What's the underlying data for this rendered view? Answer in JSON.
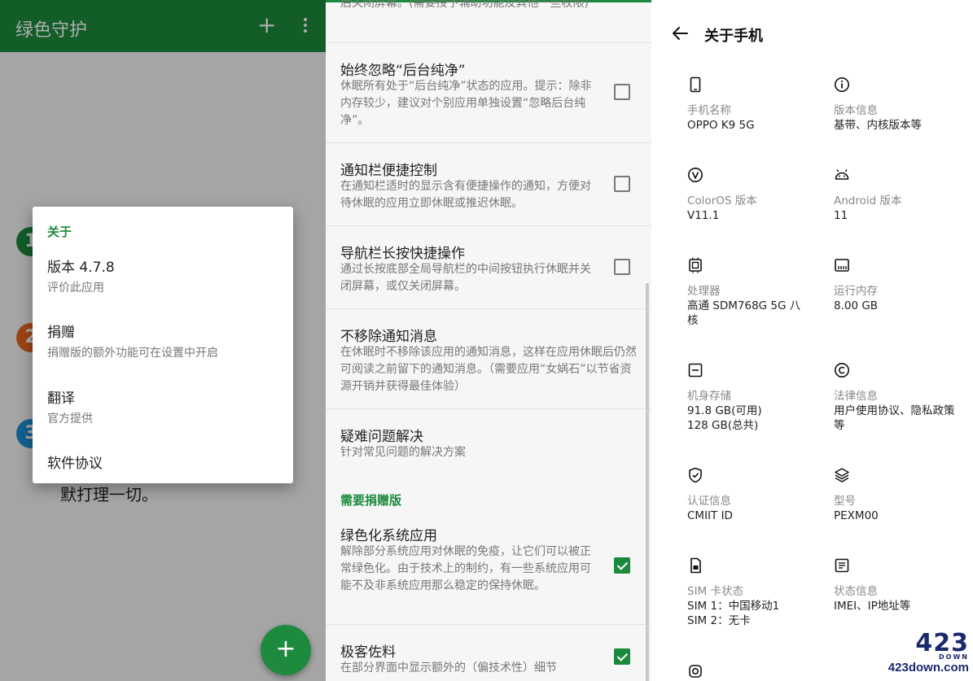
{
  "panel_about": {
    "app_title": "绿色守护",
    "step_numbers": [
      "1",
      "2",
      "3"
    ],
    "behind_text": "默打理一切。",
    "dialog": {
      "heading": "关于",
      "items": [
        {
          "title": "版本 4.7.8",
          "subtitle": "评价此应用"
        },
        {
          "title": "捐赠",
          "subtitle": "捐赠版的额外功能可在设置中开启"
        },
        {
          "title": "翻译",
          "subtitle": "官方提供"
        },
        {
          "title": "软件协议",
          "subtitle": ""
        }
      ]
    },
    "fab_label": "+"
  },
  "panel_settings": {
    "partial_top": "后关闭屏幕。(需要授予辅助功能及其他一些权限)",
    "items": [
      {
        "title": "始终忽略“后台纯净”",
        "desc": "休眠所有处于“后台纯净”状态的应用。提示：除非内存较少，建议对个别应用单独设置“忽略后台纯净”。",
        "checked": false
      },
      {
        "title": "通知栏便捷控制",
        "desc": "在通知栏适时的显示含有便捷操作的通知，方便对待休眠的应用立即休眠或推迟休眠。",
        "checked": false
      },
      {
        "title": "导航栏长按快捷操作",
        "desc": "通过长按底部全局导航栏的中间按钮执行休眠并关闭屏幕，或仅关闭屏幕。",
        "checked": false
      },
      {
        "title": "不移除通知消息",
        "desc": "在休眠时不移除该应用的通知消息，这样在应用休眠后仍然可阅读之前留下的通知消息。（需要应用“女娲石”以节省资源开销并获得最佳体验）"
      },
      {
        "title": "疑难问题解决",
        "desc": "针对常见问题的解决方案"
      }
    ],
    "section_donate": "需要捐赠版",
    "donate_items": [
      {
        "title": "绿色化系统应用",
        "desc": "解除部分系统应用对休眠的免疫，让它们可以被正常绿色化。由于技术上的制约，有一些系统应用可能不及非系统应用那么稳定的保持休眠。",
        "checked": true
      },
      {
        "title": "极客佐料",
        "desc": "在部分界面中显示额外的（偏技术性）细节",
        "checked": true
      }
    ]
  },
  "panel_phone": {
    "title": "关于手机",
    "cells": [
      {
        "icon": "phone-icon",
        "label": "手机名称",
        "value": "OPPO K9 5G"
      },
      {
        "icon": "info-icon",
        "label": "版本信息",
        "value": "基带、内核版本等"
      },
      {
        "icon": "coloros-icon",
        "label": "ColorOS 版本",
        "value": "V11.1"
      },
      {
        "icon": "android-icon",
        "label": "Android 版本",
        "value": "11"
      },
      {
        "icon": "cpu-icon",
        "label": "处理器",
        "value": "高通 SDM768G 5G 八核"
      },
      {
        "icon": "memory-icon",
        "label": "运行内存",
        "value": "8.00 GB"
      },
      {
        "icon": "storage-icon",
        "label": "机身存储",
        "value": "91.8 GB(可用)\n128 GB(总共)"
      },
      {
        "icon": "copyright-icon",
        "label": "法律信息",
        "value": "用户使用协议、隐私政策等"
      },
      {
        "icon": "shield-icon",
        "label": "认证信息",
        "value": "CMIIT ID"
      },
      {
        "icon": "layers-icon",
        "label": "型号",
        "value": "PEXM00"
      },
      {
        "icon": "sim-icon",
        "label": "SIM 卡状态",
        "value": "SIM 1：中国移动1\nSIM 2：无卡"
      },
      {
        "icon": "status-icon",
        "label": "状态信息",
        "value": "IMEI、IP地址等"
      }
    ]
  },
  "watermark": {
    "big": "423",
    "sub": "DOWN",
    "url": "423down.com"
  }
}
